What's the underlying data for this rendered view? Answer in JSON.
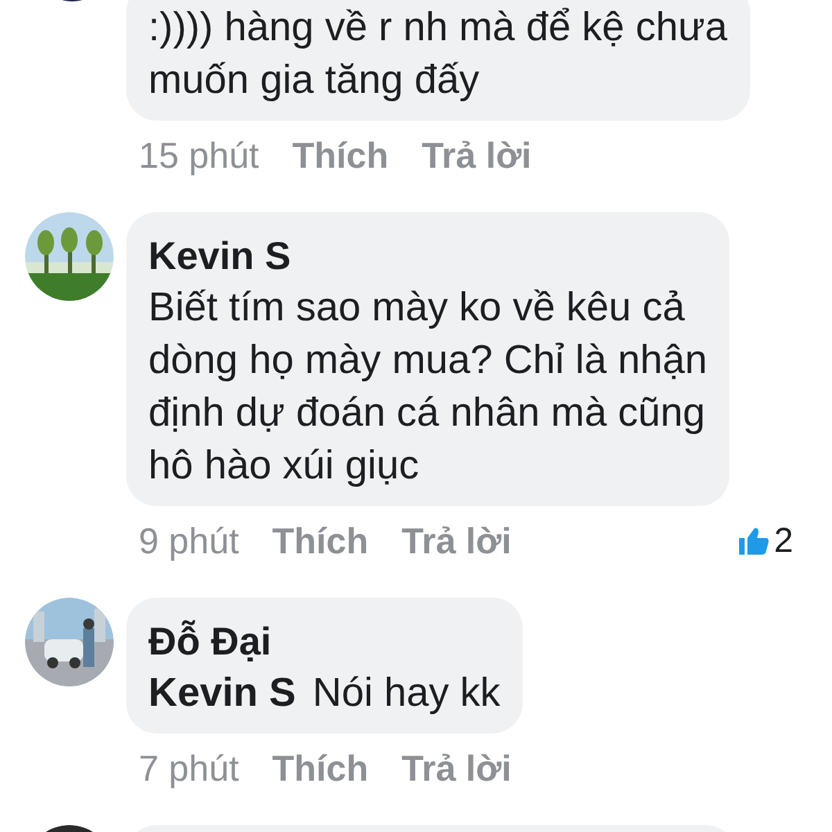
{
  "comments": [
    {
      "kind": "cut_top",
      "lines": [
        ":)))) hàng về r nh mà để kệ chưa",
        "muốn gia tăng đấy"
      ],
      "actions": {
        "time": "15 phút",
        "like": "Thích",
        "reply": "Trả lời"
      }
    },
    {
      "kind": "full",
      "author": "Kevin S",
      "lines": [
        "Biết tím sao mày ko về kêu cả",
        "dòng họ mày mua? Chỉ là nhận",
        "định dự đoán cá nhân mà cũng",
        "hô hào xúi giục"
      ],
      "actions": {
        "time": "9 phút",
        "like": "Thích",
        "reply": "Trả lời"
      },
      "like_count": "2"
    },
    {
      "kind": "full",
      "author": "Đỗ Đại",
      "mention": "Kevin S",
      "lines": [
        "Nói hay kk"
      ],
      "actions": {
        "time": "7 phút",
        "like": "Thích",
        "reply": "Trả lời"
      }
    },
    {
      "kind": "cut_bottom"
    }
  ]
}
